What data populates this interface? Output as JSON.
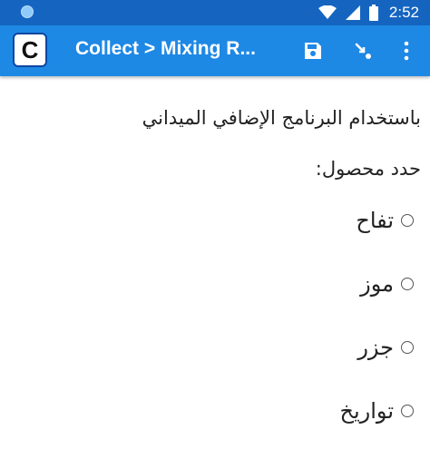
{
  "status_bar": {
    "time": "2:52"
  },
  "app_bar": {
    "logo_letter": "C",
    "title": "Collect > Mixing R..."
  },
  "question": {
    "hint": "باستخدام البرنامج الإضافي الميداني",
    "label": "حدد محصول:",
    "options": [
      {
        "label": "تفاح",
        "selected": false
      },
      {
        "label": "موز",
        "selected": false
      },
      {
        "label": "جزر",
        "selected": false
      },
      {
        "label": "تواريخ",
        "selected": false
      }
    ]
  },
  "colors": {
    "status_bar": "#1565c0",
    "app_bar": "#1e88e5",
    "background": "#ffffff",
    "text": "#222222"
  }
}
